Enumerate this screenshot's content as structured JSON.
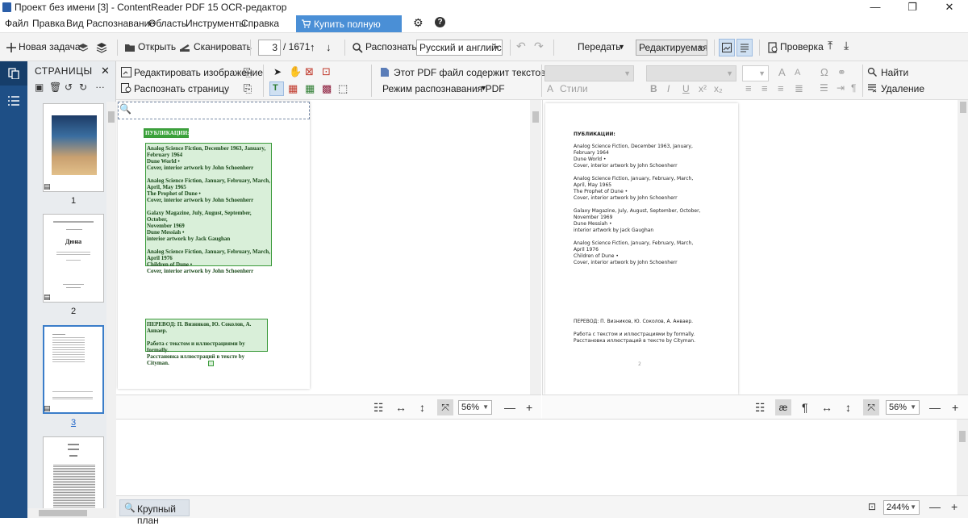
{
  "window": {
    "title": "Проект без имени [3] - ContentReader PDF 15 OCR-редактор",
    "controls": [
      "—",
      "❐",
      "✕"
    ]
  },
  "menu": {
    "items": [
      "Файл",
      "Правка",
      "Вид",
      "Распознавание",
      "Область",
      "Инструменты",
      "Справка"
    ],
    "buy_label": "Купить полную версию"
  },
  "toolbar": {
    "new_task": "Новая задача",
    "open": "Открыть",
    "scan": "Сканировать",
    "page_current": "3",
    "page_total": "/ 1671",
    "recognize": "Распознать",
    "language": "Русский и английски",
    "send": "Передать",
    "mode": "Редактируемая к",
    "check": "Проверка"
  },
  "pages_panel": {
    "header": "СТРАНИЦЫ",
    "pages": [
      {
        "number": "1",
        "selected": false
      },
      {
        "number": "2",
        "selected": false
      },
      {
        "number": "3",
        "selected": true
      }
    ],
    "thumb2_title": "Дюна"
  },
  "image_toolbar": {
    "edit_image": "Редактировать изображение",
    "recognize_page": "Распознать страницу",
    "pdf_text_layer": "Этот PDF файл содержит текстовый слой",
    "pdf_mode": "Режим распознавания PDF",
    "styles": "Стили",
    "find": "Найти",
    "delete": "Удаление"
  },
  "image_page": {
    "heading": "ПУБЛИКАЦИИ:",
    "block1": [
      "Analog Science Fiction, December 1963, January,",
      "February 1964",
      "Dune World •",
      "Cover, interior artwork by John Schoenherr",
      "",
      "Analog Science Fiction, January, February, March,",
      "April, May 1965",
      "The Prophet of Dune •",
      "Cover, interior artwork by John Schoenherr",
      "",
      "Galaxy Magazine, July, August, September, October,",
      "November 1969",
      "Dune Messiah •",
      "interior artwork by Jack Gaughan",
      "",
      "Analog Science Fiction, January, February, March,",
      "April 1976",
      "Children of Dune •",
      "Cover, interior artwork by John Schoenherr"
    ],
    "block2": [
      "ПЕРЕВОД: П. Визников, Ю. Соколов, А. Анвaeр.",
      "",
      "Работа с текстом и иллюстрациями by formally.",
      "Расстановка иллюстраций в тексте by Cityman."
    ]
  },
  "text_page": {
    "heading": "ПУБЛИКАЦИИ:",
    "block1": [
      "Analog Science Fiction, December 1963, January,",
      "February 1964",
      "Dune World •",
      "Cover, interior artwork by John Schoenherr",
      "",
      "Analog Science Fiction, January, February, March,",
      "April, May 1965",
      "The Prophet of Dune •",
      "Cover, interior artwork by John Schoenherr",
      "",
      "Galaxy Magazine, July, August, September, October,",
      "November 1969",
      "Dune Messiah •",
      "interior artwork by Jack Gaughan",
      "",
      "Analog Science Fiction, January, February, March,",
      "April 1976",
      "Children of Dune •",
      "Cover, interior artwork by John Schoenherr"
    ],
    "block2": [
      "ПЕРЕВОД: П. Визников, Ю. Соколов, А. Анвaeр.",
      "",
      "Работа с текстом и иллюстрациями by formally.",
      "Расстановка иллюстраций в тексте by Cityman."
    ],
    "page_mark": "2"
  },
  "zoom": {
    "image_zoom": "56%",
    "text_zoom": "56%",
    "closeup_zoom": "244%",
    "closeup_label": "Крупный план"
  },
  "colors": {
    "accent": "#4a8fd6",
    "sidebar": "#1e4f86",
    "ocr_fill": "#d9efd9",
    "ocr_border": "#3a9a3a"
  }
}
